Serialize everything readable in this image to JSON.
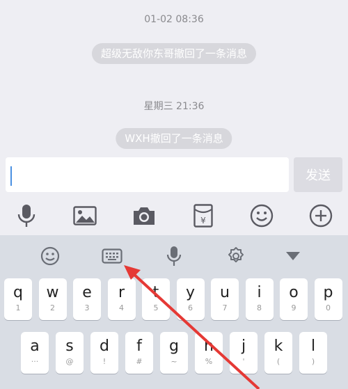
{
  "chat": {
    "timestamp1": "01-02 08:36",
    "recall1": "超级无敌你东哥撤回了一条消息",
    "timestamp2": "星期三 21:36",
    "recall2": "WXH撤回了一条消息"
  },
  "input": {
    "value": "",
    "send_label": "发送"
  },
  "toolbar_icons": [
    "microphone-icon",
    "image-icon",
    "camera-icon",
    "red-packet-icon",
    "emoji-icon",
    "plus-icon"
  ],
  "keyboard": {
    "toolbar_icons": [
      "emoji-icon",
      "keyboard-icon",
      "microphone-icon",
      "settings-icon",
      "collapse-icon"
    ],
    "row1": [
      {
        "main": "q",
        "sub": "1"
      },
      {
        "main": "w",
        "sub": "2"
      },
      {
        "main": "e",
        "sub": "3"
      },
      {
        "main": "r",
        "sub": "4"
      },
      {
        "main": "t",
        "sub": "5"
      },
      {
        "main": "y",
        "sub": "6"
      },
      {
        "main": "u",
        "sub": "7"
      },
      {
        "main": "i",
        "sub": "8"
      },
      {
        "main": "o",
        "sub": "9"
      },
      {
        "main": "p",
        "sub": "0"
      }
    ],
    "row2": [
      {
        "main": "a",
        "sub": "···"
      },
      {
        "main": "s",
        "sub": "@"
      },
      {
        "main": "d",
        "sub": "!"
      },
      {
        "main": "f",
        "sub": "#"
      },
      {
        "main": "g",
        "sub": "~"
      },
      {
        "main": "h",
        "sub": "%"
      },
      {
        "main": "j",
        "sub": "'"
      },
      {
        "main": "k",
        "sub": "("
      },
      {
        "main": "l",
        "sub": ")"
      }
    ]
  },
  "colors": {
    "accent": "#4a90e2",
    "annotation_arrow": "#e53935"
  }
}
